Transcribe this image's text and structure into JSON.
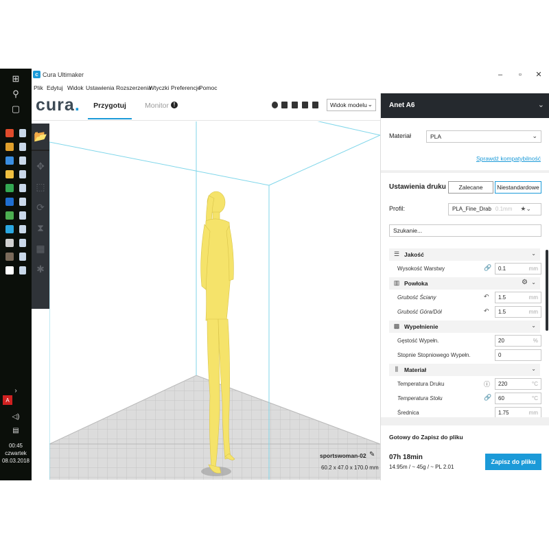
{
  "window": {
    "title": "Cura Ultimaker",
    "app_icon": "c",
    "controls": [
      "–",
      "▫",
      "✕"
    ]
  },
  "menu": [
    "Plik",
    "Edytuj",
    "Widok",
    "Ustawienia",
    "Rozszerzenia",
    "Wtyczki",
    "Preferencje",
    "Pomoc"
  ],
  "toolbar": {
    "logo": "cura",
    "tabs": [
      {
        "label": "Przygotuj",
        "active": true
      },
      {
        "label": "Monitor",
        "active": false
      }
    ],
    "monitor_badge": "!",
    "view_buttons": [
      "3d-view-icon",
      "front-view-icon",
      "top-view-icon",
      "left-view-icon",
      "right-view-icon"
    ],
    "view_select": "Widok modelu"
  },
  "tools": [
    "open-file-icon",
    "move-icon",
    "scale-icon",
    "rotate-icon",
    "mirror-icon",
    "per-model-settings-icon",
    "support-blocker-icon"
  ],
  "taskbar": {
    "icons": [
      "windows-start-icon",
      "search-icon",
      "task-view-icon"
    ],
    "app_colors": [
      "#e04b2c",
      "#e0a02c",
      "#3a8ee0",
      "#f0c040",
      "#33a852",
      "#1f6fd0",
      "#4caf50",
      "#2aa7e0",
      "#d0d0d0",
      "#7a6a5a",
      "#ffffff"
    ],
    "tray_icons": [
      "chevron-up-icon",
      "acrobat-icon",
      "volume-icon",
      "notifications-icon"
    ],
    "time": "00:45",
    "day": "czwartek",
    "date": "08.03.2018"
  },
  "viewport": {
    "model_name": "sportswoman-02",
    "model_dims": "60.2 x 47.0 x 170.0 mm",
    "model_color": "#f5e36a",
    "buildplate_color": "#d8d8d8",
    "volume_line_color": "#6fd0e8"
  },
  "sidebar": {
    "printer": "Anet A6",
    "material_label": "Materiał",
    "material_value": "PLA",
    "compat_link": "Sprawdź kompatybilność",
    "print_settings_title": "Ustawienia druku",
    "mode_recommended": "Zalecane",
    "mode_custom": "Niestandardowe",
    "profile_label": "Profil:",
    "profile_value": "PLA_Fine_Drab",
    "profile_hint": "0.1mm",
    "search_placeholder": "Szukanie...",
    "accent": "#1b9ad8"
  },
  "settings": [
    {
      "type": "category",
      "label": "Jakość",
      "icon": "quality-icon"
    },
    {
      "type": "setting",
      "label": "Wysokość Warstwy",
      "value": "0.1",
      "unit": "mm",
      "icon": "link-icon",
      "italic": false
    },
    {
      "type": "category",
      "label": "Powłoka",
      "icon": "shell-icon",
      "gear": true
    },
    {
      "type": "setting",
      "label": "Grubość Ściany",
      "value": "1.5",
      "unit": "mm",
      "icon": "reset-icon",
      "italic": true
    },
    {
      "type": "setting",
      "label": "Grubość Góra/Dół",
      "value": "1.5",
      "unit": "mm",
      "icon": "reset-icon",
      "italic": true
    },
    {
      "type": "category",
      "label": "Wypełnienie",
      "icon": "infill-icon"
    },
    {
      "type": "setting",
      "label": "Gęstość Wypełn.",
      "value": "20",
      "unit": "%",
      "icon": "",
      "italic": false
    },
    {
      "type": "setting",
      "label": "Stopnie Stopniowego Wypełn.",
      "value": "0",
      "unit": "",
      "icon": "",
      "italic": false
    },
    {
      "type": "category",
      "label": "Materiał",
      "icon": "material-icon"
    },
    {
      "type": "setting",
      "label": "Temperatura Druku",
      "value": "220",
      "unit": "°C",
      "icon": "info-icon",
      "italic": false
    },
    {
      "type": "setting",
      "label": "Temperatura Stołu",
      "value": "60",
      "unit": "°C",
      "icon": "link-icon",
      "italic": true
    },
    {
      "type": "setting",
      "label": "Średnica",
      "value": "1.75",
      "unit": "mm",
      "icon": "",
      "italic": false
    }
  ],
  "footer": {
    "ready_label": "Gotowy do Zapisz do pliku",
    "print_time": "07h 18min",
    "print_info": "14.95m / ~ 45g / ~ PL 2.01",
    "save_button": "Zapisz do pliku"
  }
}
